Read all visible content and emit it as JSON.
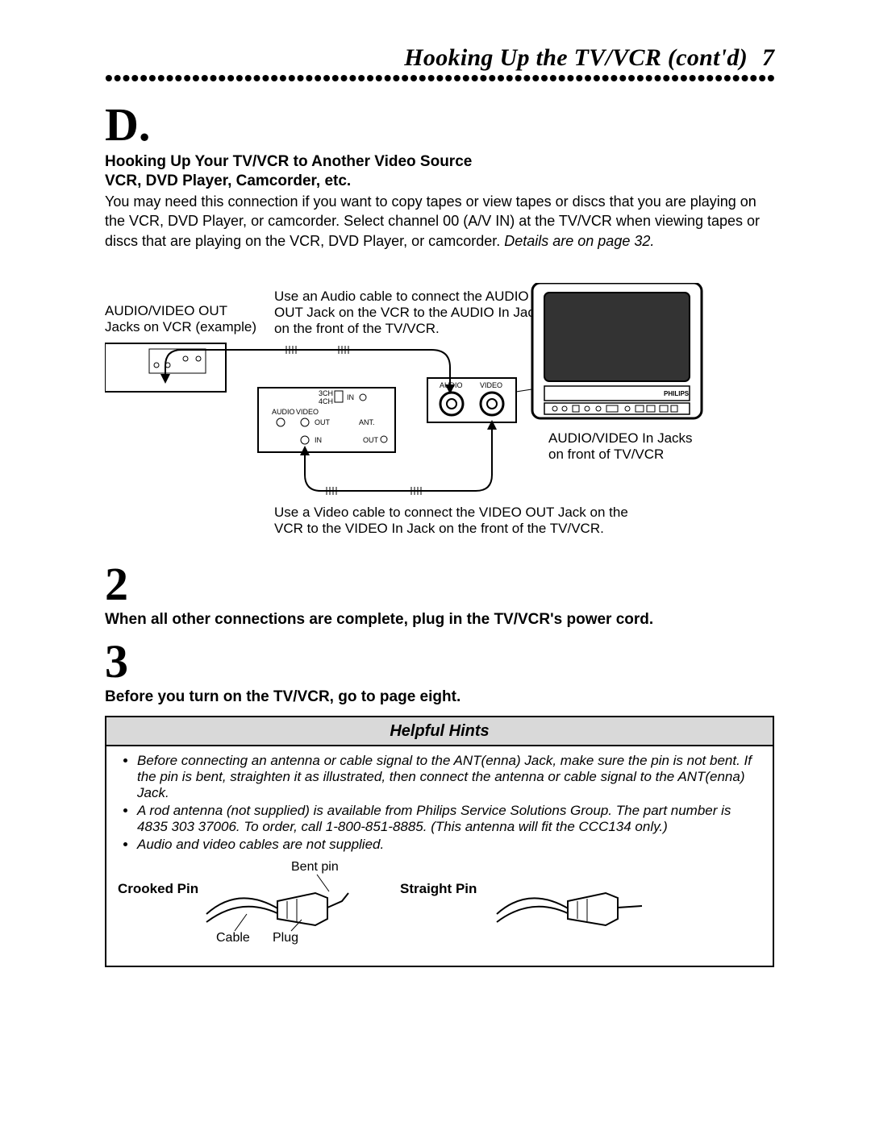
{
  "header": {
    "title": "Hooking Up the TV/VCR (cont'd)",
    "page_number": "7"
  },
  "section": {
    "step_letter": "D.",
    "heading_line1": "Hooking Up Your TV/VCR to Another Video Source",
    "heading_line2": "VCR, DVD Player, Camcorder, etc.",
    "paragraph_main": "You may need this connection if you want to copy tapes or view tapes or discs that you are playing on the VCR, DVD Player, or camcorder. Select channel 00 (A/V IN) at the TV/VCR when viewing tapes or discs that are playing on the VCR, DVD Player, or camcorder.",
    "paragraph_details": "Details are on page 32."
  },
  "diagram": {
    "av_out_line1": "AUDIO/VIDEO OUT",
    "av_out_line2": "Jacks on VCR (example)",
    "audio_cable_note_line1": "Use an Audio cable to connect the AUDIO",
    "audio_cable_note_line2": "OUT Jack on the VCR to the AUDIO In Jack",
    "audio_cable_note_line3": "on the front of the TV/VCR.",
    "av_in_line1": "AUDIO/VIDEO In Jacks",
    "av_in_line2": "on front of TV/VCR",
    "video_cable_note_line1": "Use a Video cable to connect the VIDEO OUT Jack on the",
    "video_cable_note_line2": "VCR to the VIDEO In Jack on the front of the TV/VCR.",
    "panel": {
      "audio_label": "AUDIO",
      "video_label": "VIDEO",
      "ch3": "3CH",
      "ch4": "4CH",
      "in": "IN",
      "out": "OUT",
      "ant": "ANT."
    },
    "front_audio": "AUDIO",
    "front_video": "VIDEO",
    "brand": "PHILIPS"
  },
  "step2": {
    "number": "2",
    "text": "When all other connections are complete, plug in the TV/VCR's power cord."
  },
  "step3": {
    "number": "3",
    "text": "Before you turn on the TV/VCR, go to page eight."
  },
  "hints": {
    "header": "Helpful Hints",
    "bullet1": "Before connecting an antenna or cable signal to the ANT(enna) Jack, make sure the pin is not bent. If the pin is bent, straighten it as illustrated, then connect the antenna or cable signal to the ANT(enna) Jack.",
    "bullet2": "A rod antenna (not supplied) is available from Philips Service Solutions Group. The part number is 4835 303 37006. To order, call 1-800-851-8885. (This antenna will fit the CCC134 only.)",
    "bullet3": "Audio and video cables are not supplied.",
    "crooked_pin": "Crooked Pin",
    "straight_pin": "Straight Pin",
    "bent_pin": "Bent pin",
    "cable": "Cable",
    "plug": "Plug"
  }
}
